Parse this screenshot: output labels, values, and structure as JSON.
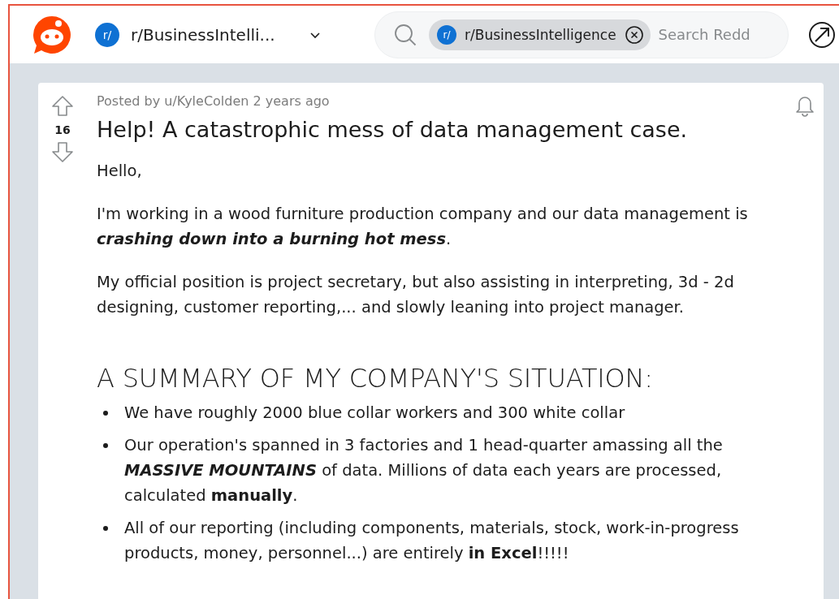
{
  "header": {
    "community": {
      "icon_text": "r/",
      "name": "r/BusinessIntelli..."
    },
    "search": {
      "chip": {
        "icon_text": "r/",
        "label": "r/BusinessIntelligence"
      },
      "placeholder": "Search Redd"
    }
  },
  "post": {
    "votes": "16",
    "meta": "Posted by u/KyleColden 2 years ago",
    "title": "Help! A catastrophic mess of data management case.",
    "paragraphs": [
      "Hello,",
      "I'm working in a wood furniture production company and our data management is *crashing down into a burning hot mess*.",
      "My official position is project secretary, but also assisting in interpreting, 3d - 2d designing, customer reporting,... and slowly leaning into project manager."
    ],
    "heading": "A SUMMARY OF MY COMPANY'S SITUATION:",
    "bullets": [
      "We have roughly 2000 blue collar workers and 300 white collar",
      "Our operation's spanned in 3 factories and 1 head-quarter amassing all the *MASSIVE MOUNTAINS* of data. Millions of data each years are processed, calculated **manually**.",
      "All of our reporting (including components, materials, stock, work-in-progress products, money, personnel...) are entirely **in Excel**!!!!!"
    ]
  }
}
